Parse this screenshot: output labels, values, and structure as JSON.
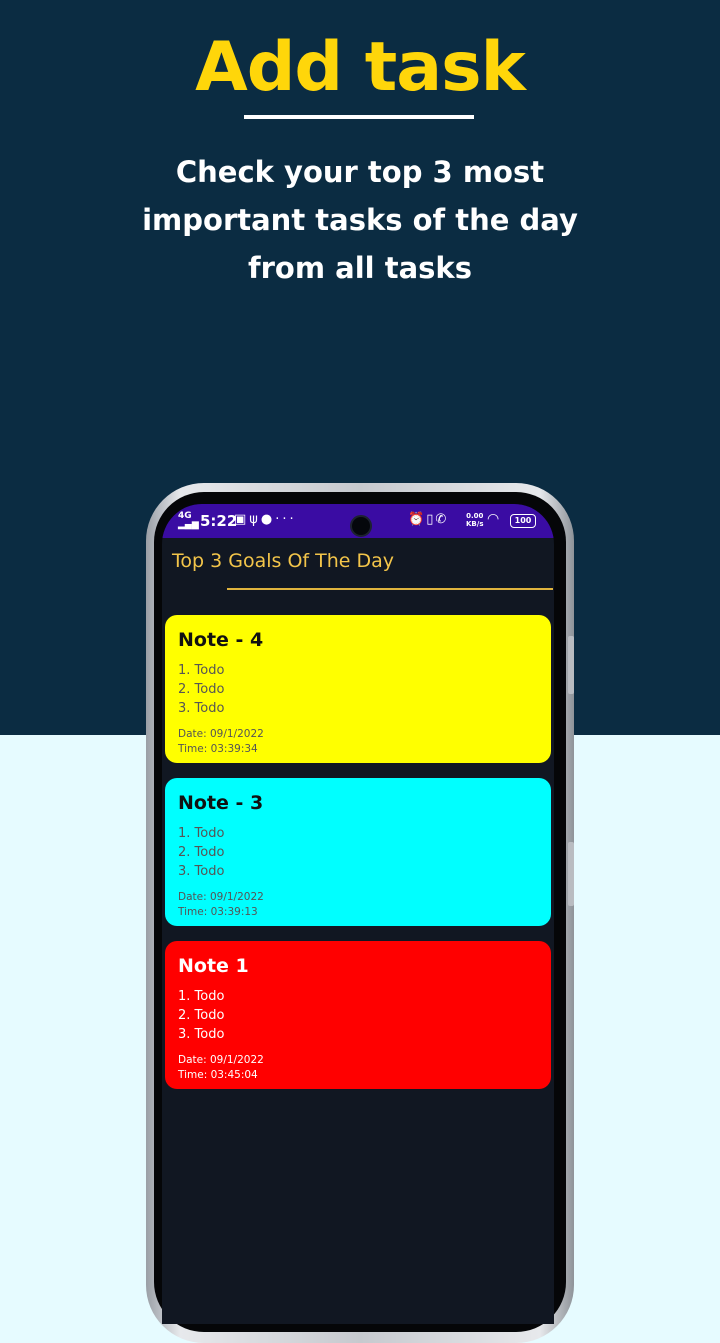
{
  "promo": {
    "headline": "Add task",
    "subtitle": "Check your top 3 most important tasks of the day from all tasks"
  },
  "status_bar": {
    "signal": "4G",
    "time": "5:22",
    "left_icons": [
      "notification-icon",
      "usb-icon",
      "sync-icon",
      "more-icon"
    ],
    "right_icons": [
      "alarm-icon",
      "vibrate-icon",
      "call-icon"
    ],
    "net_speed_value": "0.00",
    "net_speed_unit": "KB/s",
    "battery": "100"
  },
  "app": {
    "title": "Top 3 Goals Of The Day",
    "notes": [
      {
        "title": "Note - 4",
        "items": [
          "1. Todo",
          "2. Todo",
          "3. Todo"
        ],
        "date": "Date: 09/1/2022",
        "time": "Time: 03:39:34",
        "color": "#ffff00"
      },
      {
        "title": "Note - 3",
        "items": [
          "1. Todo",
          "2. Todo",
          "3. Todo"
        ],
        "date": "Date: 09/1/2022",
        "time": "Time: 03:39:13",
        "color": "#00ffff"
      },
      {
        "title": "Note 1",
        "items": [
          "1. Todo",
          "2. Todo",
          "3. Todo"
        ],
        "date": "Date: 09/1/2022",
        "time": "Time: 03:45:04",
        "color": "#ff0000"
      }
    ]
  },
  "colors": {
    "top_background": "#0b2c42",
    "bottom_background": "#e6fbff",
    "headline": "#ffd60a",
    "status_bar": "#3a0ca3",
    "app_background": "#111722",
    "app_title": "#f3c54a"
  }
}
